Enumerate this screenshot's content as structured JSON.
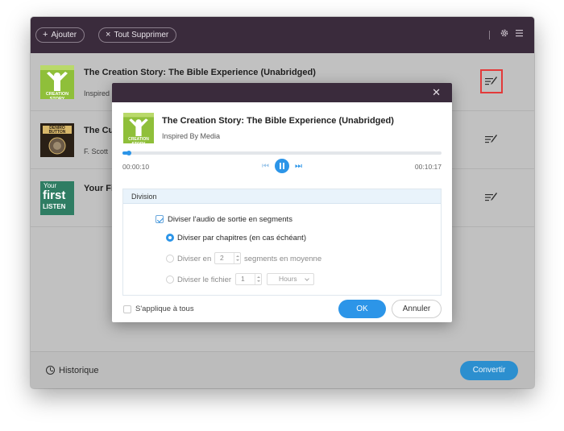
{
  "toolbar": {
    "add_label": "Ajouter",
    "clear_label": "Tout Supprimer",
    "settings_icon": "gear-icon",
    "menu_icon": "menu-icon"
  },
  "books": [
    {
      "title": "The Creation Story: The Bible Experience (Unabridged)",
      "author": "Inspired",
      "cover_lines": [
        "CREATION STORY"
      ],
      "cover_colors": {
        "bg": "#8fbf3a",
        "accent": "#ffffff"
      }
    },
    {
      "title": "The Cu",
      "author": "F. Scott",
      "cover_lines": [
        "DENIRO",
        "BUTTON"
      ],
      "cover_colors": {
        "bg": "#2a2016",
        "accent": "#d8b86a"
      }
    },
    {
      "title": "Your Fi",
      "author": "",
      "cover_lines": [
        "Your",
        "first",
        "LISTEN"
      ],
      "cover_colors": {
        "bg": "#2f7d63",
        "accent": "#ffffff"
      }
    }
  ],
  "footer": {
    "history_label": "Historique",
    "convert_label": "Convertir"
  },
  "dialog": {
    "title": "The Creation Story: The Bible Experience (Unabridged)",
    "author": "Inspired By Media",
    "close_icon": "close-icon",
    "elapsed": "00:00:10",
    "duration": "00:10:17",
    "progress": 0.02,
    "section_title": "Division",
    "split_label": "Diviser l'audio de sortie en segments",
    "split_checked": true,
    "options": [
      {
        "label": "Diviser par chapitres (en cas échéant)",
        "selected": true
      },
      {
        "label": "Diviser en",
        "value": "2",
        "suffix": "segments en moyenne",
        "selected": false
      },
      {
        "label": "Diviser le fichier",
        "value": "1",
        "unit": "Hours",
        "selected": false
      }
    ],
    "apply_all_label": "S'applique à tous",
    "apply_all_checked": false,
    "ok_label": "OK",
    "cancel_label": "Annuler"
  },
  "colors": {
    "titlebar": "#3a2b3c",
    "accent": "#2c95e8",
    "highlight": "#e33a3a"
  }
}
